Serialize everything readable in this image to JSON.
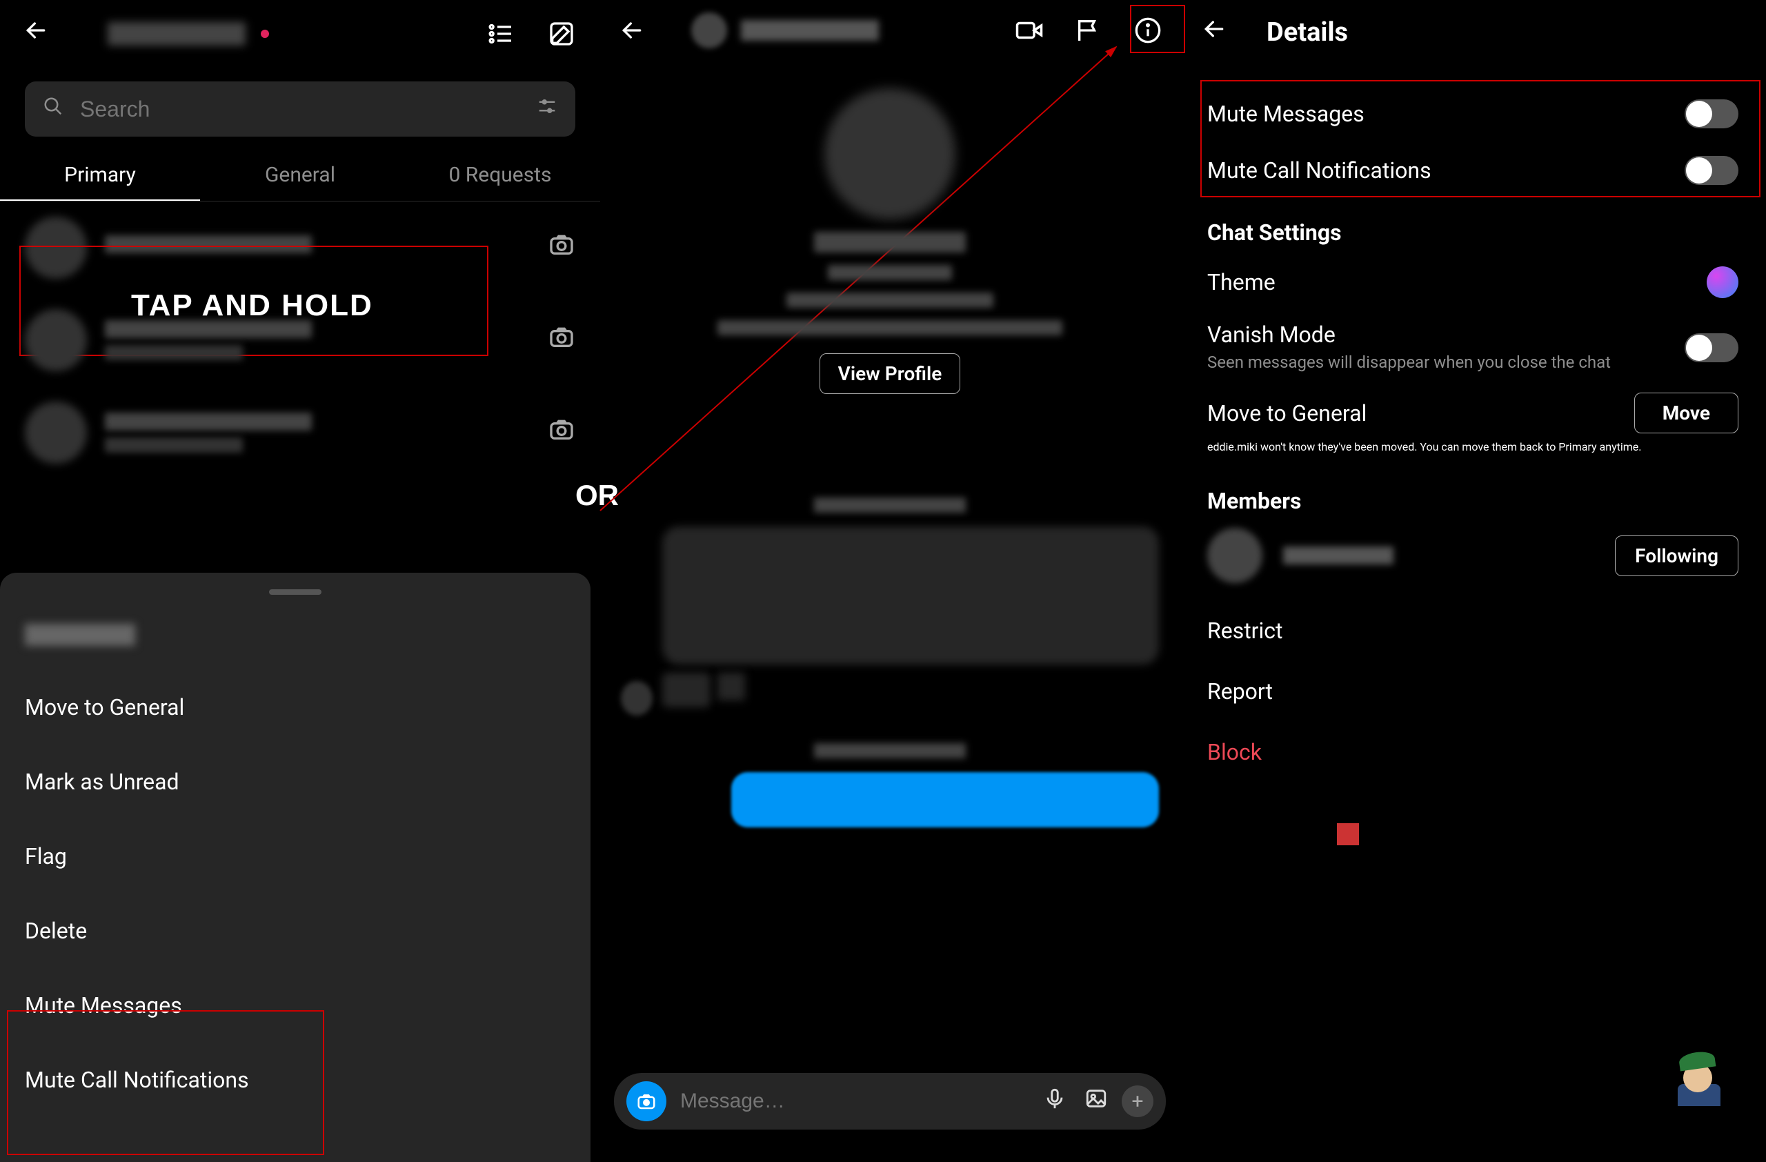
{
  "left": {
    "search_placeholder": "Search",
    "tabs": {
      "primary": "Primary",
      "general": "General",
      "requests": "0 Requests"
    },
    "tap_hold_label": "TAP AND HOLD",
    "context_menu": {
      "move": "Move to General",
      "unread": "Mark as Unread",
      "flag": "Flag",
      "delete": "Delete",
      "mute_messages": "Mute Messages",
      "mute_calls": "Mute Call Notifications"
    }
  },
  "or_label": "OR",
  "mid": {
    "view_profile": "View Profile",
    "message_placeholder": "Message…"
  },
  "right": {
    "title": "Details",
    "mute_messages": "Mute Messages",
    "mute_calls": "Mute Call Notifications",
    "chat_settings": "Chat Settings",
    "theme": "Theme",
    "vanish": "Vanish Mode",
    "vanish_sub": "Seen messages will disappear when you close the chat",
    "move_general": "Move to General",
    "move_btn": "Move",
    "move_sub": "eddie.miki won't know they've been moved. You can move them back to Primary anytime.",
    "members": "Members",
    "following": "Following",
    "restrict": "Restrict",
    "report": "Report",
    "block": "Block"
  }
}
